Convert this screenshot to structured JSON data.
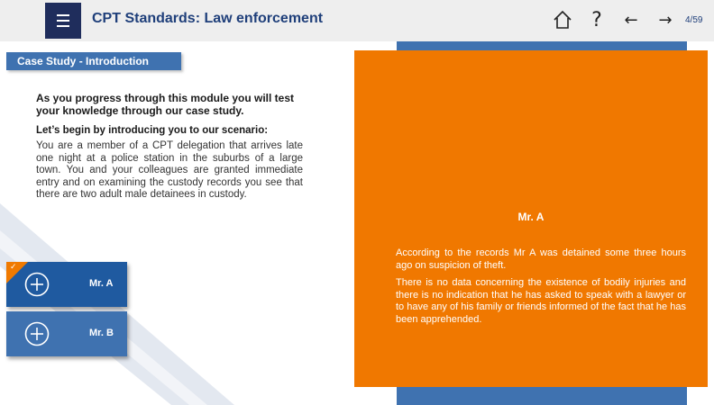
{
  "header": {
    "title": "CPT Standards: Law enforcement",
    "page_counter": "4/59",
    "icons": [
      "menu-icon",
      "home-icon",
      "help-icon",
      "arrow-left-icon",
      "arrow-right-icon"
    ],
    "help_glyph": "?",
    "back_glyph": "←",
    "forward_glyph": "→"
  },
  "section": {
    "tab_label": "Case Study - Introduction"
  },
  "intro": {
    "lead": "As you progress through this module you will test your knowledge through our case study.",
    "subheading": "Let’s begin by introducing you to our scenario:",
    "body": "You are a member of a CPT delegation that arrives late one night at a police station in the suburbs of a large town. You and your colleagues are granted immediate entry and on examining the custody records you see that there are two adult male detainees in custody."
  },
  "detainees": [
    {
      "label": "Mr. A",
      "visited": true
    },
    {
      "label": "Mr. B",
      "visited": false
    }
  ],
  "panel": {
    "title": "Mr. A",
    "paragraph_1": "According to the records Mr A was detained some three hours ago on suspicion of theft.",
    "paragraph_2": "There is no data concerning the existence of bodily injuries and there is no indication that he has asked to speak with a lawyer or to have any of his family or friends informed of the fact that he has been apprehended."
  },
  "colors": {
    "navy": "#1f2d5c",
    "title_blue": "#1f3f7a",
    "button_blue": "#3f72b0",
    "button_blue_active": "#1f5aa0",
    "orange": "#f07800"
  },
  "check_glyph": "✓"
}
